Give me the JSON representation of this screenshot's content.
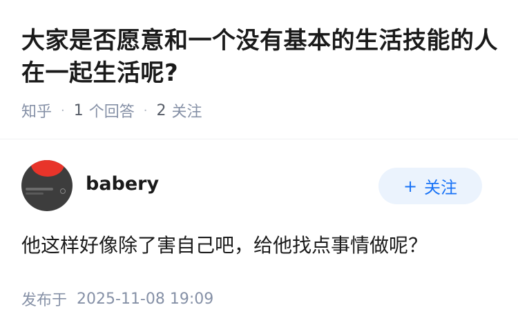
{
  "question": {
    "title": "大家是否愿意和一个没有基本的生活技能的人在一起生活呢?",
    "source": "知乎",
    "answer_count": "1",
    "answer_label": "个回答",
    "follower_count": "2",
    "follower_label": "关注"
  },
  "answer": {
    "author_name": "babery",
    "follow_plus": "+",
    "follow_label": "关注",
    "content": "他这样好像除了害自己吧，给他找点事情做呢？",
    "publish_label": "发布于",
    "publish_time": "2025-11-08 19:09"
  },
  "colors": {
    "accent": "#1772f6",
    "follow_bg": "#ebf3fd",
    "meta_text": "#8590a6"
  }
}
